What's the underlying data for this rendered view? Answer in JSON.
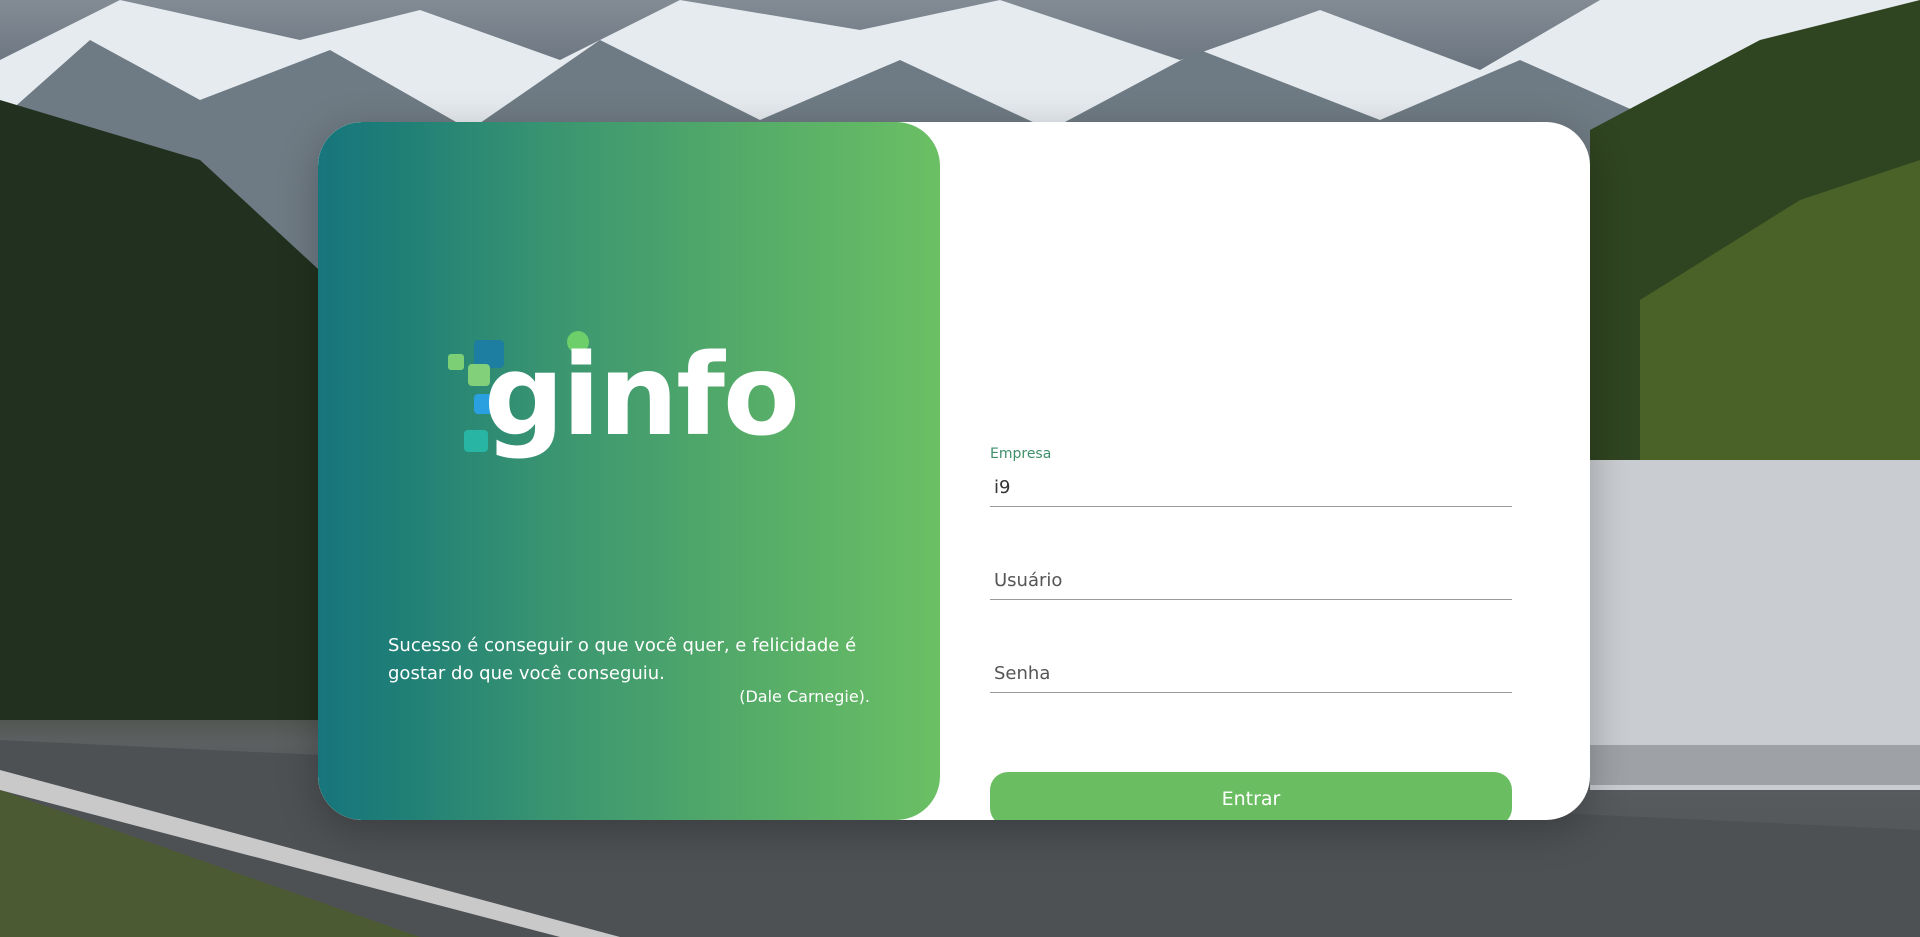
{
  "brand": {
    "logo_text": "ginfo",
    "gradient_start": "#17757c",
    "gradient_end": "#6bbf64"
  },
  "quote": {
    "text": "Sucesso é conseguir o que você quer, e felicidade é gostar do que você conseguiu.",
    "author": "(Dale Carnegie)."
  },
  "form": {
    "empresa": {
      "label": "Empresa",
      "value": "i9"
    },
    "usuario": {
      "placeholder": "Usuário",
      "value": ""
    },
    "senha": {
      "placeholder": "Senha",
      "value": ""
    },
    "submit_label": "Entrar",
    "accent_color": "#6bbd62"
  }
}
